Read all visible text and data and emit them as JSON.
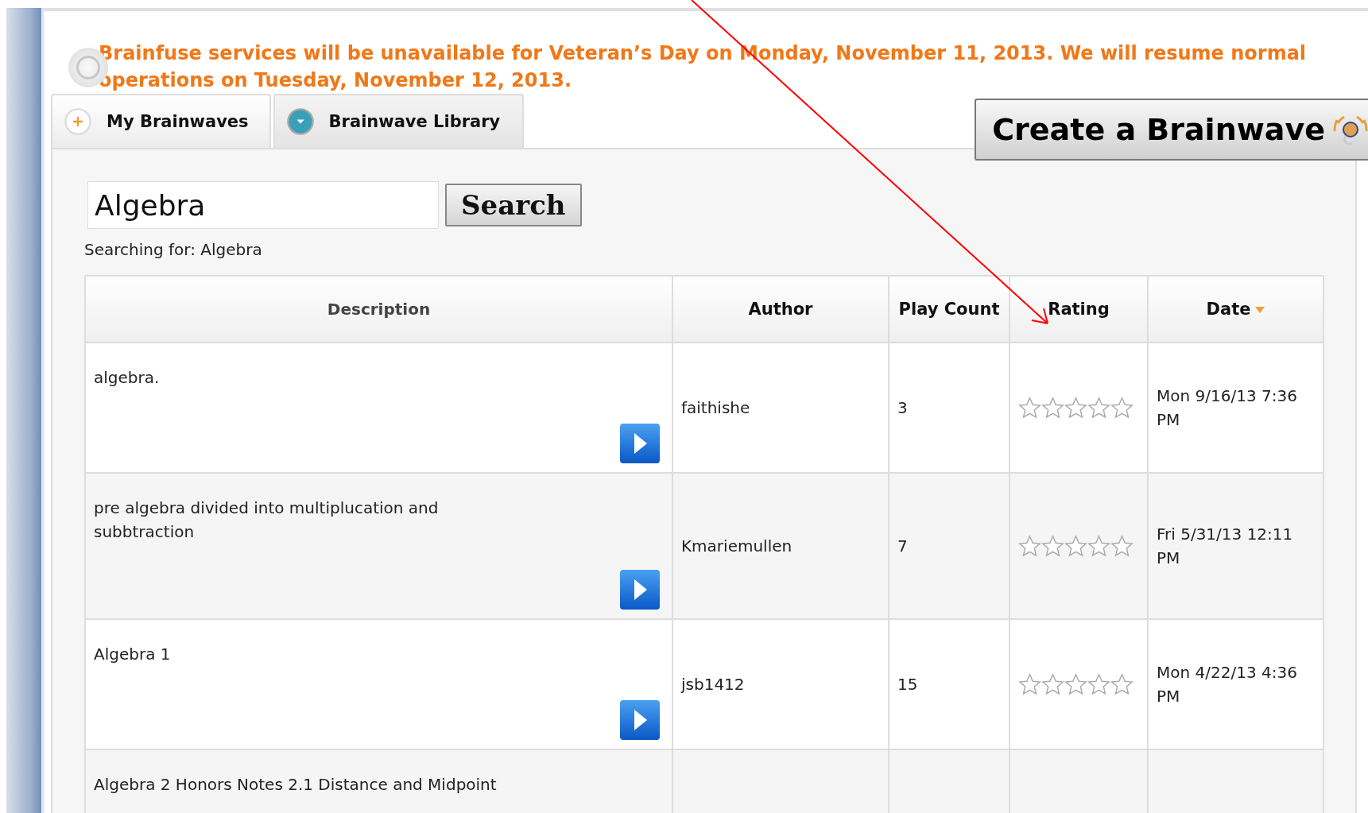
{
  "notice": "Brainfuse services will be unavailable for Veteran’s Day on Monday, November 11, 2013. We will resume normal operations on Tuesday, November 12, 2013.",
  "tabs": [
    {
      "label": "My Brainwaves",
      "kind": "plus",
      "selected": false
    },
    {
      "label": "Brainwave Library",
      "kind": "down",
      "selected": true
    }
  ],
  "create_button": "Create a Brainwave",
  "search": {
    "value": "Algebra",
    "button": "Search",
    "status": "Searching for: Algebra"
  },
  "table": {
    "columns": [
      {
        "label": "Description",
        "sorted": false
      },
      {
        "label": "Author",
        "sorted": false
      },
      {
        "label": "Play Count",
        "sorted": false
      },
      {
        "label": "Rating",
        "sorted": false
      },
      {
        "label": "Date",
        "sorted": true
      }
    ],
    "rows": [
      {
        "description": "algebra.",
        "author": "faithishe",
        "play_count": "3",
        "stars": 0,
        "date": "Mon 9/16/13 7:36 PM"
      },
      {
        "description": "pre algebra divided into multiplucation and subbtraction",
        "author": "Kmariemullen",
        "play_count": "7",
        "stars": 0,
        "date": "Fri 5/31/13 12:11 PM"
      },
      {
        "description": "Algebra 1",
        "author": "jsb1412",
        "play_count": "15",
        "stars": 0,
        "date": "Mon 4/22/13 4:36 PM"
      },
      {
        "description": "Algebra 2 Honors Notes 2.1 Distance and Midpoint"
      }
    ]
  }
}
